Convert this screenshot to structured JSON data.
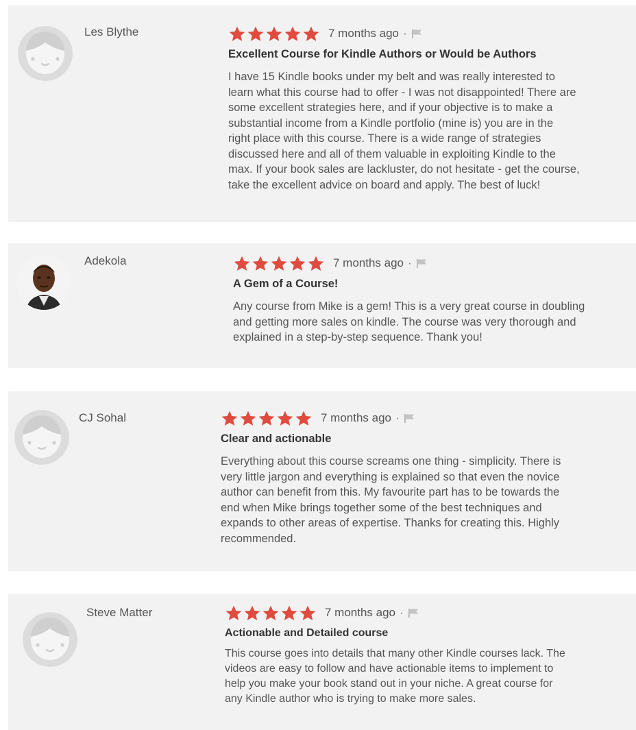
{
  "star_color": "#e04b3f",
  "reviews": [
    {
      "name": "Les Blythe",
      "avatar": "default-face-icon",
      "rating": 5,
      "time_ago": "7 months ago",
      "separator": "·",
      "title": "Excellent Course for Kindle Authors or Would be Authors",
      "body": "I have 15 Kindle books under my belt and was really interested to\nlearn what this course had to offer - I was not disappointed! There are\nsome excellent strategies here, and if your objective is to make a\nsubstantial income from a Kindle portfolio (mine is) you are in the\nright place with this course. There is a wide range of strategies\ndiscussed here and all of them valuable in exploiting Kindle to the\nmax. If your book sales are lackluster, do not hesitate - get the course,\ntake the excellent advice on board and apply. The best of luck!"
    },
    {
      "name": "Adekola",
      "avatar": "user-photo",
      "rating": 5,
      "time_ago": "7 months ago",
      "separator": "·",
      "title": "A Gem of a Course!",
      "body": "Any course from Mike is a gem! This is a very great course in doubling\nand getting more sales on kindle. The course was very thorough and\nexplained in a step-by-step sequence. Thank you!"
    },
    {
      "name": "CJ Sohal",
      "avatar": "default-face-icon",
      "rating": 5,
      "time_ago": "7 months ago",
      "separator": "·",
      "title": "Clear and actionable",
      "body": "Everything about this course screams one thing - simplicity. There is\nvery little jargon and everything is explained so that even the novice\nauthor can benefit from this. My favourite part has to be towards the\nend when Mike brings together some of the best techniques and\nexpands to other areas of expertise. Thanks for creating this. Highly\nrecommended."
    },
    {
      "name": "Steve Matter",
      "avatar": "default-face-icon",
      "rating": 5,
      "time_ago": "7 months ago",
      "separator": "·",
      "title": "Actionable and Detailed course",
      "body": "This course goes into details that many other Kindle courses lack. The\nvideos are easy to follow and have actionable items to implement to\nhelp you make your book stand out in your niche. A great course for\nany Kindle author who is trying to make more sales."
    }
  ]
}
